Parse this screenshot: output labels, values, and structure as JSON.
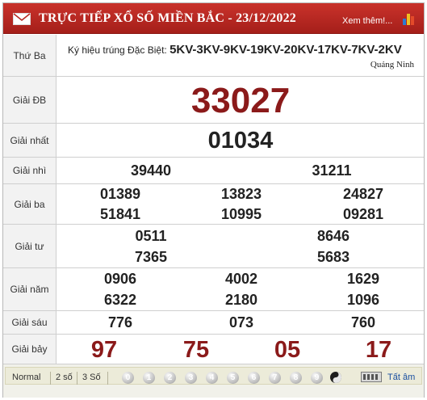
{
  "header": {
    "title": "TRỰC TIẾP XỔ SỐ MIỀN BẮC - 23/12/2022",
    "more_link": "Xem thêm!..."
  },
  "info": {
    "day": "Thứ Ba",
    "special_codes_label": "Ký hiệu trúng Đặc Biệt:",
    "special_codes": "5KV-3KV-9KV-19KV-20KV-17KV-7KV-2KV",
    "province": "Quảng Ninh"
  },
  "prizes": {
    "db": {
      "label": "Giải ĐB",
      "numbers": [
        "33027"
      ]
    },
    "nhat": {
      "label": "Giải nhất",
      "numbers": [
        "01034"
      ]
    },
    "nhi": {
      "label": "Giải nhì",
      "numbers": [
        "39440",
        "31211"
      ]
    },
    "ba": {
      "label": "Giải ba",
      "numbers": [
        "01389",
        "13823",
        "24827",
        "51841",
        "10995",
        "09281"
      ]
    },
    "tu": {
      "label": "Giải tư",
      "numbers": [
        "0511",
        "8646",
        "7365",
        "5683"
      ]
    },
    "nam": {
      "label": "Giải năm",
      "numbers": [
        "0906",
        "4002",
        "1629",
        "6322",
        "2180",
        "1096"
      ]
    },
    "sau": {
      "label": "Giải sáu",
      "numbers": [
        "776",
        "073",
        "760"
      ]
    },
    "bay": {
      "label": "Giải bảy",
      "numbers": [
        "97",
        "75",
        "05",
        "17"
      ]
    }
  },
  "footer": {
    "tabs": [
      "Normal",
      "2 số",
      "3 Số"
    ],
    "digits": [
      "0",
      "1",
      "2",
      "3",
      "4",
      "5",
      "6",
      "7",
      "8",
      "9"
    ],
    "all_label": "Tất âm"
  },
  "colors": {
    "header_bg": "#b52620",
    "special_prize": "#8b1a1a",
    "prize_seven": "#8b1a1a"
  }
}
